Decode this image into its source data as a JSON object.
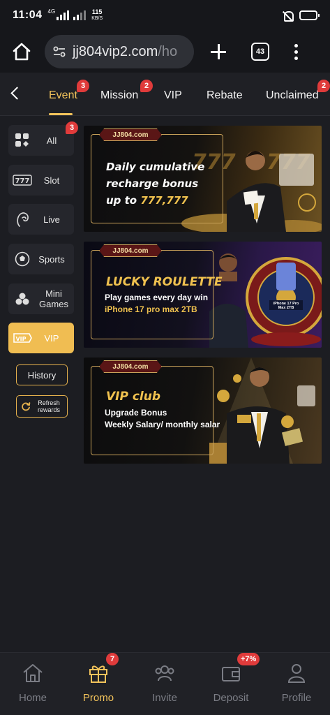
{
  "status_bar": {
    "time": "11:04",
    "network_type": "4G",
    "speed_value": "115",
    "speed_unit": "KB/S"
  },
  "browser": {
    "url_main": "jj804vip2.com",
    "url_rest": "/ho",
    "tab_count": "43"
  },
  "top_nav": {
    "tabs": [
      {
        "label": "Event",
        "badge": "3",
        "active": true
      },
      {
        "label": "Mission",
        "badge": "2"
      },
      {
        "label": "VIP"
      },
      {
        "label": "Rebate"
      },
      {
        "label": "Unclaimed",
        "badge": "2"
      }
    ]
  },
  "sidebar": {
    "items": [
      {
        "label": "All",
        "badge": "3",
        "icon": "grid-icon"
      },
      {
        "label": "Slot",
        "icon": "slot-777-icon"
      },
      {
        "label": "Live",
        "icon": "dealer-icon"
      },
      {
        "label": "Sports",
        "icon": "soccer-ball-icon"
      },
      {
        "label": "Mini Games",
        "icon": "mini-games-icon"
      },
      {
        "label": "VIP",
        "icon": "vip-tag-icon",
        "active": true
      }
    ],
    "history_label": "History",
    "refresh_label": "Refresh rewards"
  },
  "banners": [
    {
      "brand": "JJ804.com",
      "lines": [
        "Daily cumulative",
        "recharge bonus",
        "up to "
      ],
      "highlight": "777,777"
    },
    {
      "brand": "JJ804.com",
      "title": "LUCKY ROULETTE",
      "line1": "Play games every day win",
      "line2": "iPhone 17 pro max 2TB",
      "phone_label": "iPhone 17 Pro Max 2TB"
    },
    {
      "brand": "JJ804.com",
      "title": "VIP club",
      "line1": "Upgrade Bonus",
      "line2": "Weekly Salary/ monthly salar"
    }
  ],
  "bottom_nav": {
    "items": [
      {
        "label": "Home",
        "icon": "home-icon"
      },
      {
        "label": "Promo",
        "icon": "gift-icon",
        "badge": "7",
        "active": true
      },
      {
        "label": "Invite",
        "icon": "people-icon"
      },
      {
        "label": "Deposit",
        "icon": "wallet-icon",
        "badge": "+7%"
      },
      {
        "label": "Profile",
        "icon": "person-icon"
      }
    ]
  },
  "colors": {
    "accent": "#f2c35b",
    "badge": "#e03b3b",
    "background": "#1c1d22"
  }
}
